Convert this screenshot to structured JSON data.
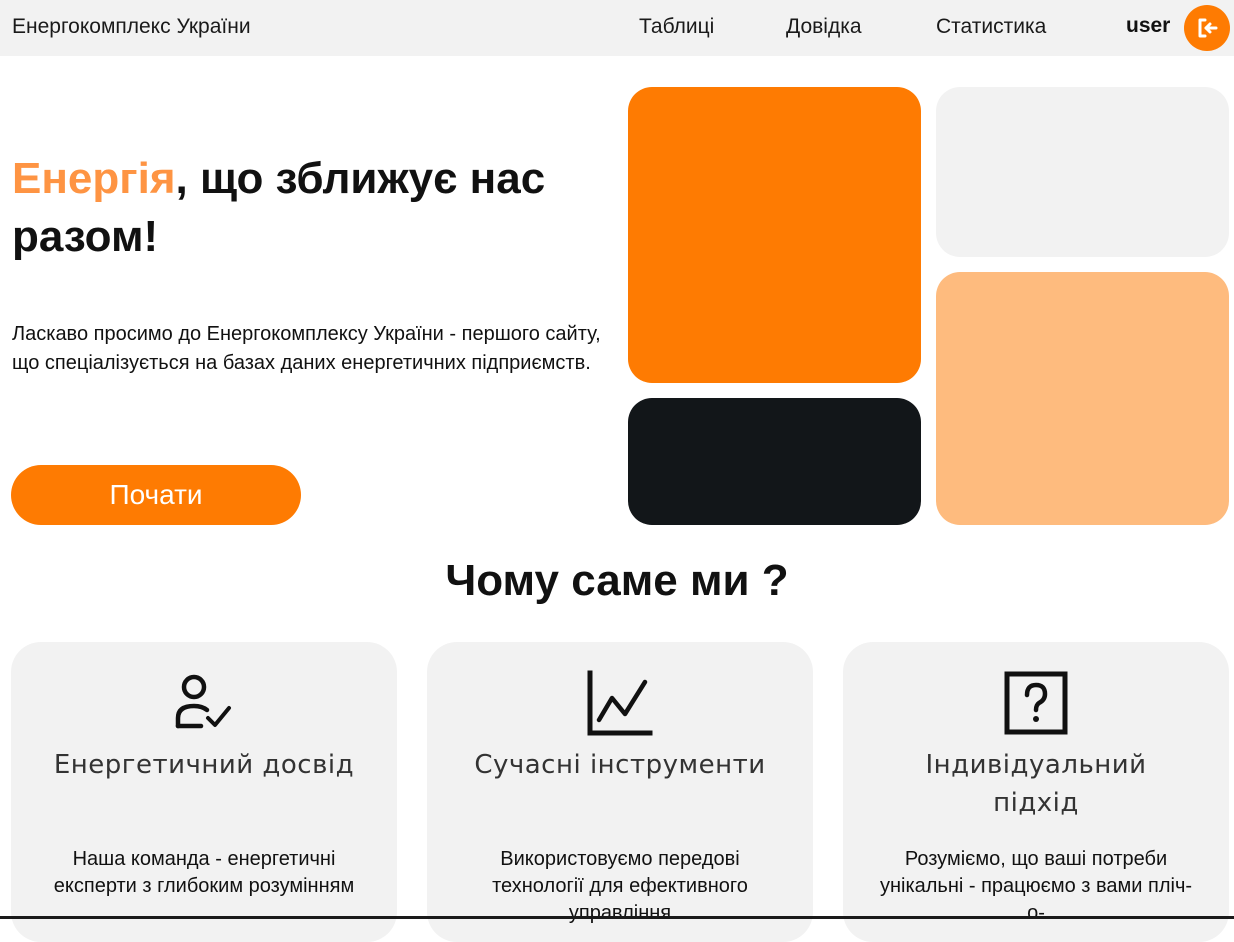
{
  "header": {
    "brand": "Енергокомплекс України",
    "nav": [
      {
        "label": "Таблиці"
      },
      {
        "label": "Довідка"
      },
      {
        "label": "Статистика"
      }
    ],
    "user": "user",
    "logout_icon": "logout-icon"
  },
  "hero": {
    "title_accent": "Енергія",
    "title_rest": ", що зближує нас разом!",
    "description": "Ласкаво просимо до Енергокомплексу України - першого сайту, що спеціалізується на базах даних енергетичних підприємств.",
    "button_label": "Почати"
  },
  "why": {
    "title": "Чому саме ми ?",
    "cards": [
      {
        "icon": "user-check-icon",
        "title": "Енергетичний досвід",
        "text": "Наша команда - енергетичні експерти з глибоким розумінням"
      },
      {
        "icon": "line-chart-icon",
        "title": "Сучасні інструменти",
        "text": "Використовуємо передові технології для ефективного управління"
      },
      {
        "icon": "question-box-icon",
        "title": "Індивідуальний підхід",
        "text": "Розуміємо, що ваші потреби унікальні - працюємо з вами пліч-о-"
      }
    ]
  },
  "colors": {
    "accent": "#fe7b02",
    "accent_light": "#febb7e",
    "accent_text": "#fe9443",
    "dark": "#121619",
    "panel": "#f2f2f2"
  }
}
